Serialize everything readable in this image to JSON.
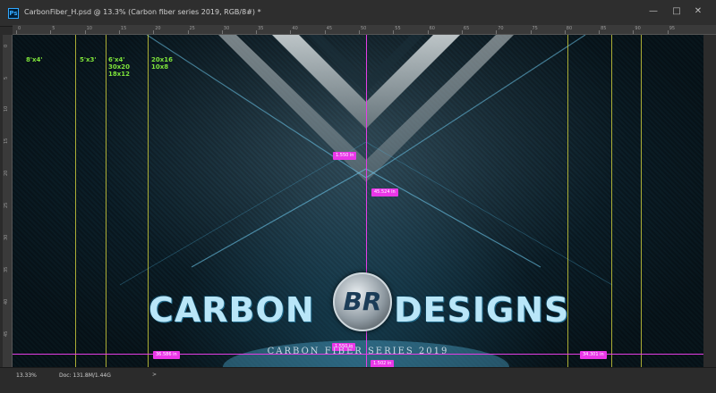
{
  "window": {
    "title": "CarbonFiber_H.psd @ 13.3% (Carbon fiber series 2019, RGB/8#) *",
    "app_icon": "Ps"
  },
  "ruler": {
    "top_ticks": [
      "0",
      "5",
      "10",
      "15",
      "20",
      "25",
      "30",
      "35",
      "40",
      "45",
      "50",
      "55",
      "60",
      "65",
      "70",
      "75",
      "80",
      "85",
      "90",
      "95"
    ],
    "left_ticks": [
      "0",
      "5",
      "10",
      "15",
      "20",
      "25",
      "30",
      "35",
      "40",
      "45"
    ]
  },
  "sizes": {
    "s8x4": "8'x4'",
    "s5x3": "5'x3'",
    "s6x4": "6'x4'",
    "s30x20": "30x20",
    "s18x12": "18x12",
    "s20x16": "20x16",
    "s10x8": "10x8"
  },
  "measurements": {
    "m_top": "1.550 in",
    "m_mid": "45.524 in",
    "m_left": "36.586 in",
    "m_center_low": "1.550 in",
    "m_bottom": "1.502 in",
    "m_right": "34.301 in"
  },
  "artwork": {
    "brand_left": "CARBON",
    "brand_right": "DESIGNS",
    "logo_letters": "BR",
    "series_text": "CARBON FIBER SERIES 2019"
  },
  "status": {
    "zoom": "13.33%",
    "doc": "Doc: 131.8M/1.44G",
    "arrow": ">"
  },
  "colors": {
    "guide_yellow": "#c8c83a",
    "guide_pink": "#e43ee6",
    "size_text": "#7ee33a"
  },
  "icons": {
    "minimize": "minimize-icon",
    "maximize": "maximize-icon",
    "close": "close-icon"
  }
}
